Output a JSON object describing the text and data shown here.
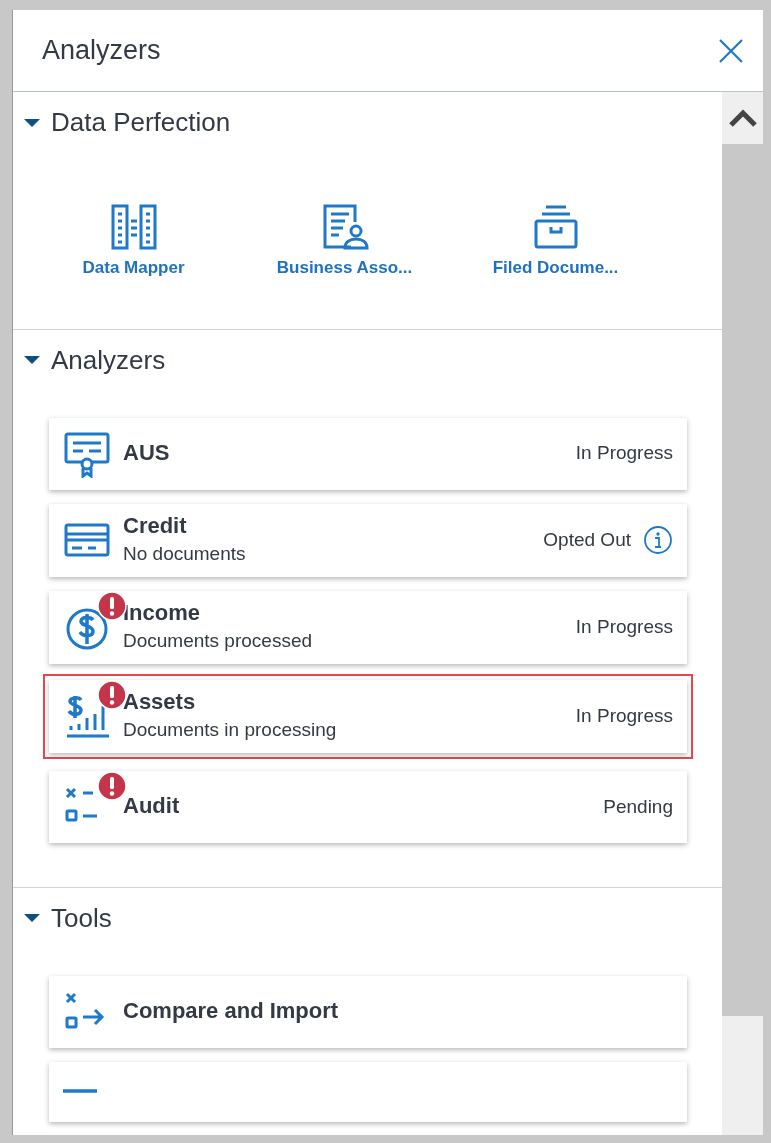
{
  "window": {
    "title": "Analyzers"
  },
  "sections": [
    {
      "title": "Data Perfection",
      "expanded": true,
      "kind": "tiles",
      "items": [
        {
          "label": "Data Mapper"
        },
        {
          "label": "Business Asso..."
        },
        {
          "label": "Filed Docume..."
        }
      ]
    },
    {
      "title": "Analyzers",
      "expanded": true,
      "kind": "cards",
      "items": [
        {
          "title": "AUS",
          "status": "In Progress",
          "alert": false,
          "info": false,
          "selected": false
        },
        {
          "title": "Credit",
          "subtitle": "No documents",
          "status": "Opted Out",
          "alert": false,
          "info": true,
          "selected": false
        },
        {
          "title": "Income",
          "subtitle": "Documents processed",
          "status": "In Progress",
          "alert": true,
          "info": false,
          "selected": false
        },
        {
          "title": "Assets",
          "subtitle": "Documents in processing",
          "status": "In Progress",
          "alert": true,
          "info": false,
          "selected": true
        },
        {
          "title": "Audit",
          "status": "Pending",
          "alert": true,
          "info": false,
          "selected": false
        }
      ]
    },
    {
      "title": "Tools",
      "expanded": true,
      "kind": "cards",
      "more_below": true,
      "items": [
        {
          "title": "Compare and Import",
          "alert": false,
          "info": false,
          "selected": false
        }
      ]
    }
  ]
}
